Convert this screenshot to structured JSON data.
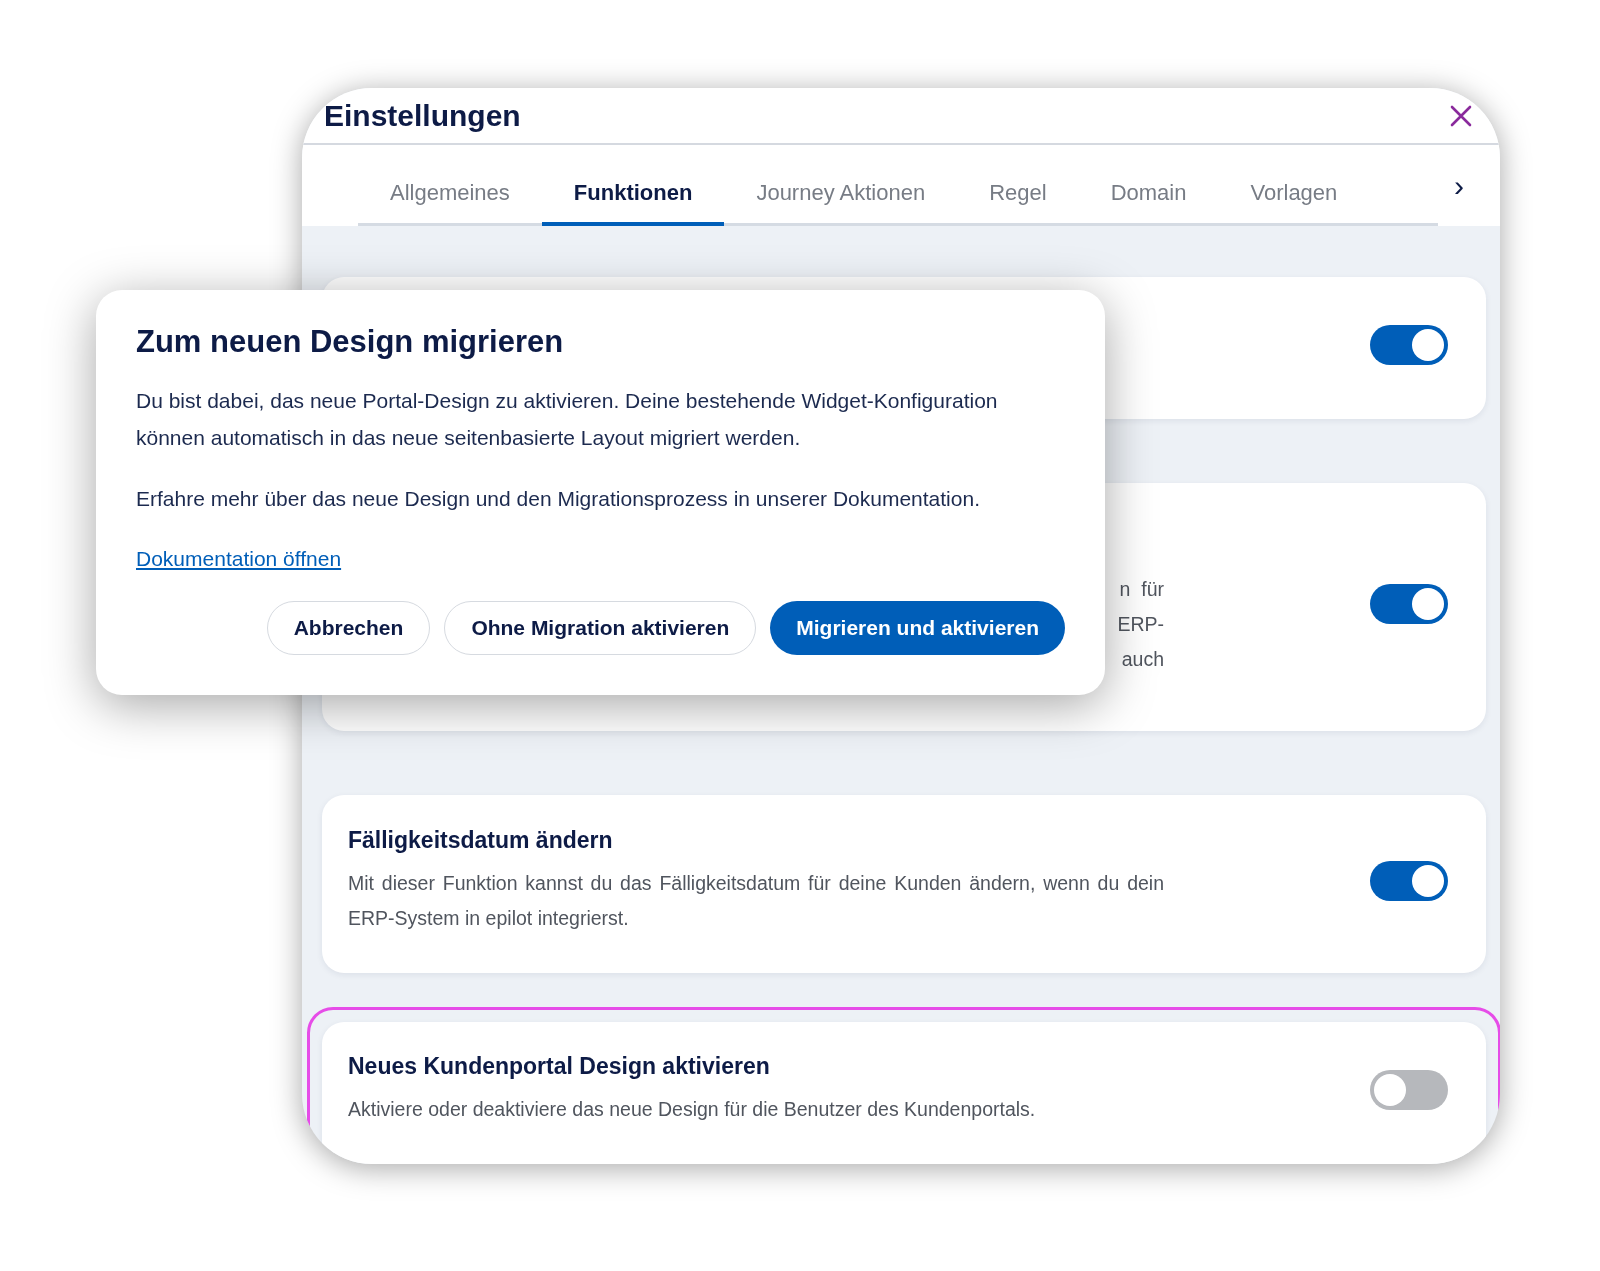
{
  "window": {
    "title": "Einstellungen"
  },
  "tabs": [
    {
      "label": "Allgemeines",
      "selected": false
    },
    {
      "label": "Funktionen",
      "selected": true
    },
    {
      "label": "Journey Aktionen",
      "selected": false
    },
    {
      "label": "Regel",
      "selected": false
    },
    {
      "label": "Domain",
      "selected": false
    },
    {
      "label": "Vorlagen",
      "selected": false
    }
  ],
  "tabs_more": "›",
  "cards": [
    {
      "on": true,
      "highlighted": false
    },
    {
      "visible_fragments": [
        "n  für",
        "ERP-",
        "auch"
      ],
      "on": true,
      "highlighted": false
    },
    {
      "title": "Fälligkeitsdatum ändern",
      "description": "Mit dieser Funktion kannst du das Fälligkeitsdatum für deine Kunden ändern, wenn du dein ERP-System in epilot integrierst.",
      "on": true,
      "highlighted": false
    },
    {
      "title": "Neues Kundenportal Design aktivieren",
      "description": "Aktiviere oder deaktiviere das neue Design für die Benutzer des Kundenportals.",
      "on": false,
      "highlighted": true
    }
  ],
  "dialog": {
    "title": "Zum neuen Design migrieren",
    "paragraphs": [
      "Du bist dabei, das neue Portal-Design zu aktivieren. Deine bestehende Widget-Konfiguration können automatisch in das neue seitenbasierte Layout migriert werden.",
      "Erfahre mehr über das neue Design und den Migrationsprozess in unserer Dokumentation."
    ],
    "link": "Dokumentation öffnen",
    "buttons": [
      {
        "label": "Abbrechen",
        "kind": "secondary"
      },
      {
        "label": "Ohne Migration aktivieren",
        "kind": "secondary"
      },
      {
        "label": "Migrieren und aktivieren",
        "kind": "primary"
      }
    ]
  }
}
